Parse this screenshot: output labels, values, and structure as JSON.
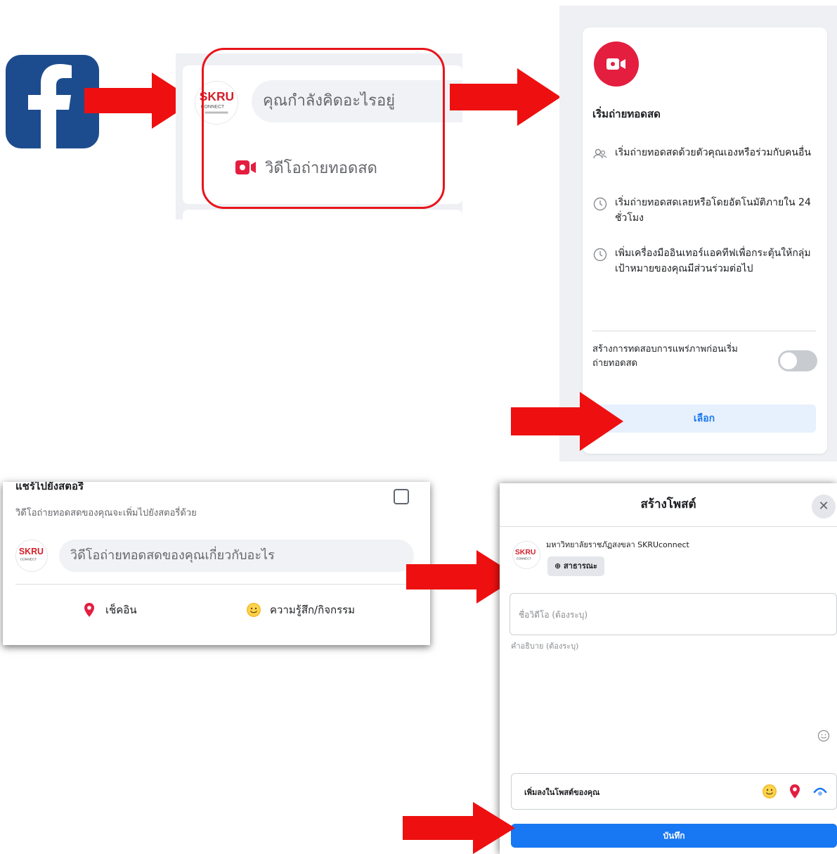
{
  "facebook": {
    "icon": "facebook-logo-icon",
    "brand_color": "#1d4c8e"
  },
  "composer": {
    "avatar_icon": "skru-connect-logo-icon",
    "placeholder": "คุณกำลังคิดอะไรอยู่",
    "live_video_label": "วิดีโอถ่ายทอดสด",
    "highlight_color": "#e8141b"
  },
  "live_panel": {
    "title": "เริ่มถ่ายทอดสด",
    "features": [
      {
        "icon": "people-icon",
        "text": "เริ่มถ่ายทอดสดด้วยตัวคุณเองหรือร่วมกับคนอื่น"
      },
      {
        "icon": "clock-icon",
        "text": "เริ่มถ่ายทอดสดเลยหรือโดยอัตโนมัติภายใน 24 ชั่วโมง"
      },
      {
        "icon": "clock-icon",
        "text": "เพิ่มเครื่องมืออินเทอร์แอคทีฟเพื่อกระตุ้นให้กลุ่มเป้าหมายของคุณมีส่วนร่วมต่อไป"
      }
    ],
    "test_broadcast_label": "สร้างการทดสอบการแพร่ภาพก่อนเริ่มถ่ายทอดสด",
    "select_button": "เลือก"
  },
  "share_story": {
    "title": "แชร์ไปยังสตอรี่",
    "subtitle": "วิดีโอถ่ายทอดสดของคุณจะเพิ่มไปยังสตอรี่ด้วย",
    "description_placeholder": "วิดีโอถ่ายทอดสดของคุณเกี่ยวกับอะไร",
    "check_in_label": "เช็คอิน",
    "feeling_label": "ความรู้สึก/กิจกรรม"
  },
  "create_post": {
    "title": "สร้างโพสต์",
    "page_name": "มหาวิทยาลัยราชภัฏสงขลา SKRUconnect",
    "audience_label": "สาธารณะ",
    "video_title_placeholder": "ชื่อวิดีโอ (ต้องระบุ)",
    "description_placeholder": "คำอธิบาย (ต้องระบุ)",
    "add_to_post_label": "เพิ่มลงในโพสต์ของคุณ",
    "save_button": "บันทึก"
  },
  "colors": {
    "accent_red": "#e41e3f",
    "facebook_blue": "#1877f2",
    "arrow_red": "#ee1010"
  }
}
